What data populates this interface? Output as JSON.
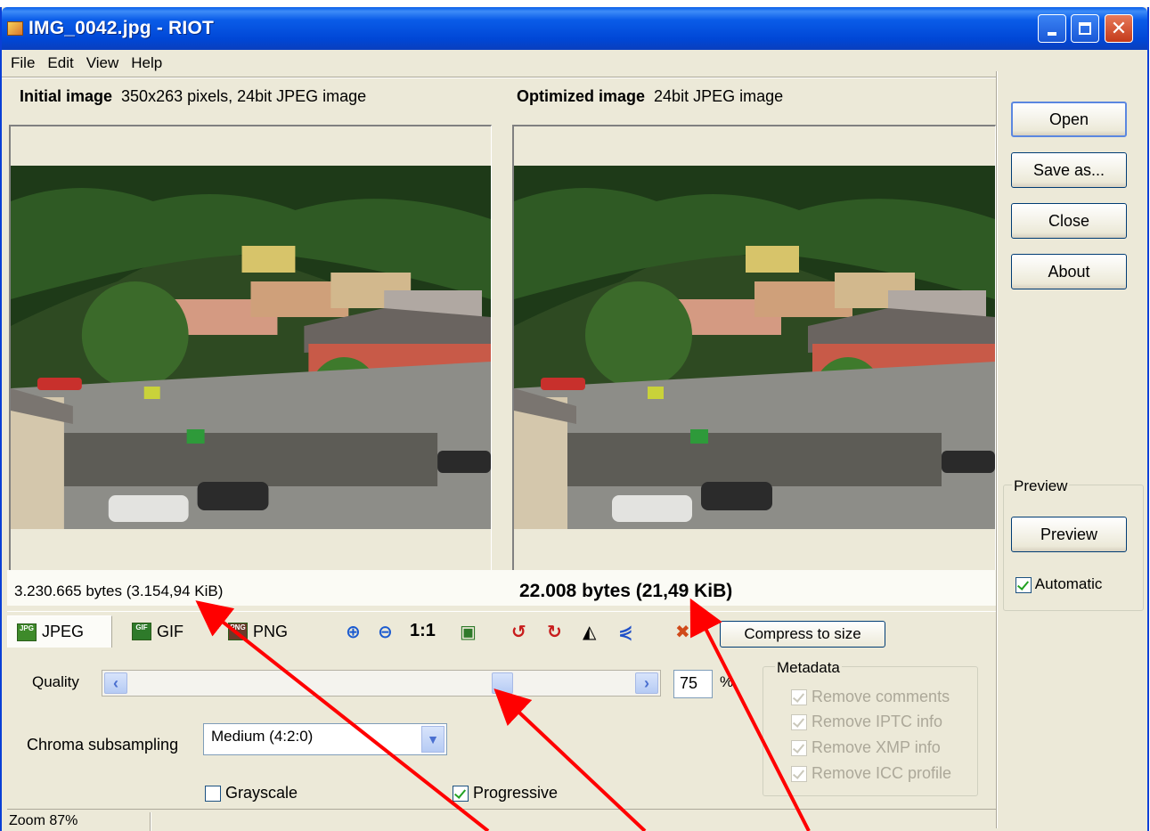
{
  "window": {
    "title": "IMG_0042.jpg - RIOT"
  },
  "menu": [
    "File",
    "Edit",
    "View",
    "Help"
  ],
  "initial": {
    "label": "Initial image",
    "info": "350x263 pixels, 24bit JPEG image",
    "size": "3.230.665 bytes (3.154,94 KiB)"
  },
  "optimized": {
    "label": "Optimized image",
    "info": "24bit JPEG image",
    "size": "22.008 bytes (21,49 KiB)"
  },
  "side_buttons": {
    "open": "Open",
    "save_as": "Save as...",
    "close": "Close",
    "about": "About"
  },
  "preview": {
    "group_label": "Preview",
    "button": "Preview",
    "automatic_label": "Automatic",
    "automatic_checked": true
  },
  "tabs": {
    "jpeg": "JPEG",
    "gif": "GIF",
    "png": "PNG",
    "active": "JPEG"
  },
  "toolbar": {
    "actual_size": "1:1",
    "compress": "Compress to size"
  },
  "quality": {
    "label": "Quality",
    "value": "75",
    "unit": "%",
    "fraction": 0.75
  },
  "chroma": {
    "label": "Chroma subsampling",
    "selected": "Medium (4:2:0)"
  },
  "options": {
    "grayscale": "Grayscale",
    "grayscale_checked": false,
    "progressive": "Progressive",
    "progressive_checked": true
  },
  "metadata": {
    "label": "Metadata",
    "items": [
      "Remove comments",
      "Remove IPTC info",
      "Remove XMP info",
      "Remove ICC profile"
    ]
  },
  "status": {
    "zoom": "Zoom 87%"
  },
  "colors": {
    "titlebar": "#0047d6",
    "annotation_arrow": "#ff0000"
  }
}
